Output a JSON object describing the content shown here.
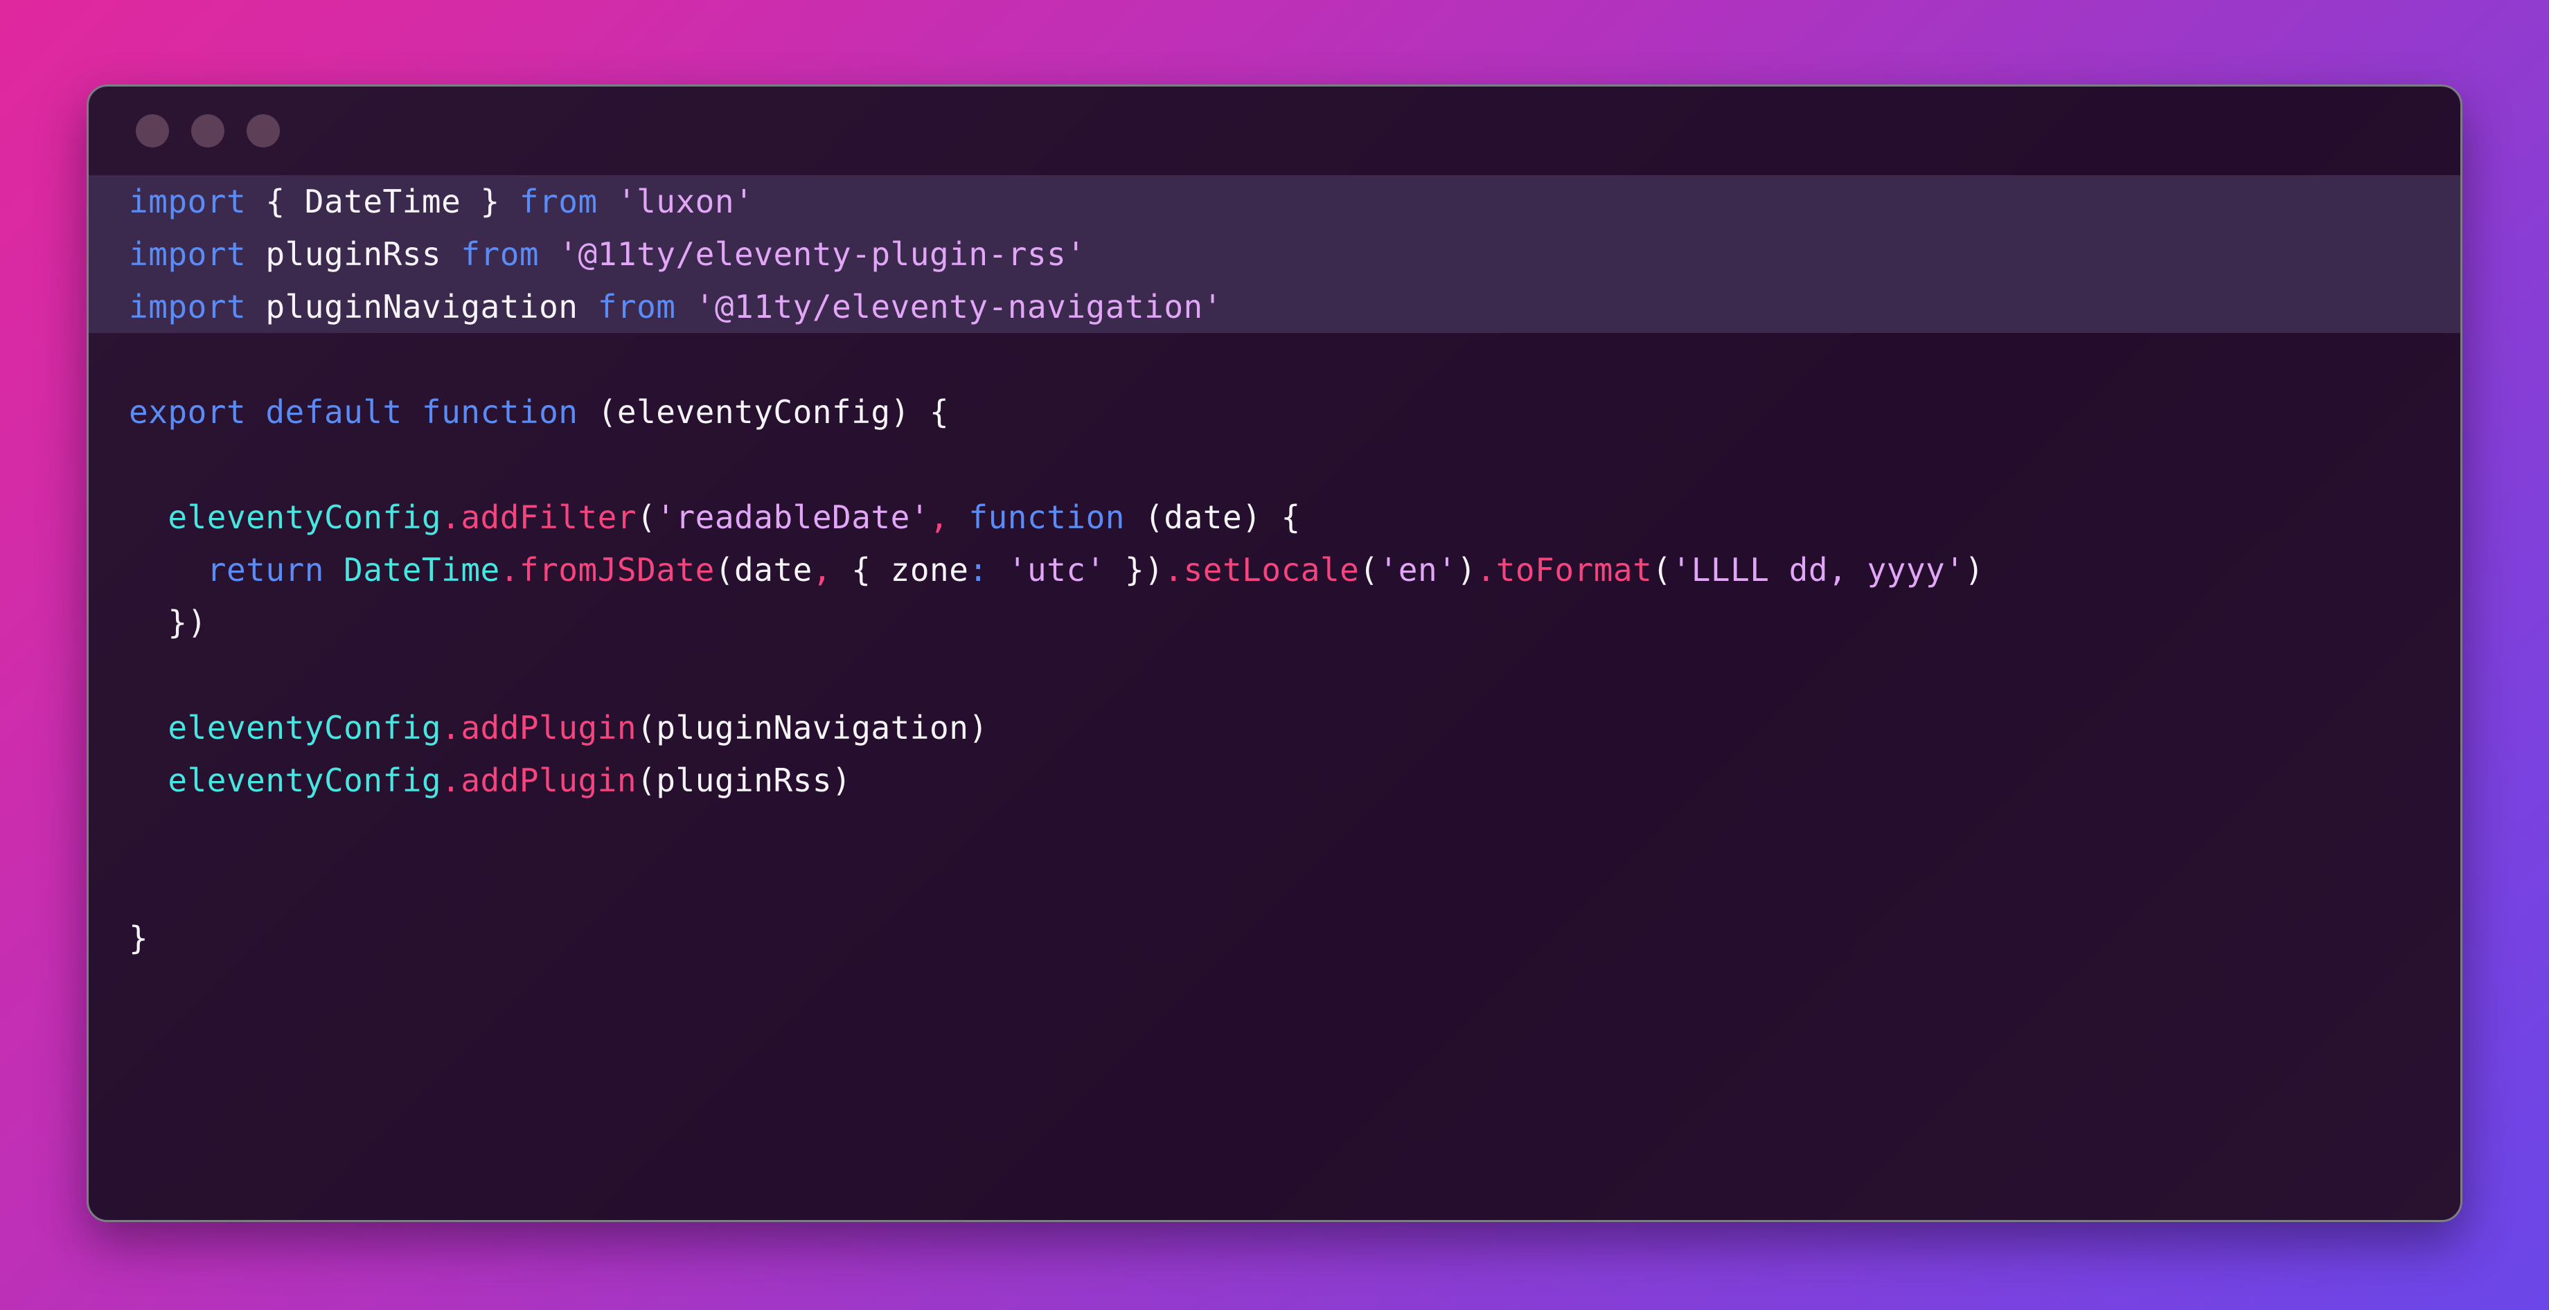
{
  "window": {
    "titlebar": {
      "dots": [
        {
          "name": "close-dot",
          "color": "#5d3f58"
        },
        {
          "name": "minimize-dot",
          "color": "#5d3f58"
        },
        {
          "name": "maximize-dot",
          "color": "#5d3f58"
        }
      ]
    },
    "background_gradient": {
      "from": "#e0289e",
      "to": "#6b46e8",
      "angle_deg": 135
    },
    "surface_color": "#240d2c",
    "highlight_color": "#3b2a4e",
    "border_color": "#7d7d85"
  },
  "theme": {
    "keyword": "#5b8cf5",
    "plain": "#f7f5fa",
    "string": "#e2a6f7",
    "object": "#47e6e0",
    "function": "#f5457f",
    "punctuation": "#f5457f",
    "colon": "#5b8cf5"
  },
  "code": {
    "language": "javascript",
    "filename_hint": "eleventy.config.js",
    "lines": [
      {
        "index": 1,
        "highlighted": true,
        "text": "import { DateTime } from 'luxon'",
        "tokens": [
          {
            "t": "import",
            "c": "kw"
          },
          {
            "t": " ",
            "c": "plain"
          },
          {
            "t": "{ DateTime }",
            "c": "plain"
          },
          {
            "t": " ",
            "c": "plain"
          },
          {
            "t": "from",
            "c": "kw"
          },
          {
            "t": " ",
            "c": "plain"
          },
          {
            "t": "'luxon'",
            "c": "str"
          }
        ]
      },
      {
        "index": 2,
        "highlighted": true,
        "text": "import pluginRss from '@11ty/eleventy-plugin-rss'",
        "tokens": [
          {
            "t": "import",
            "c": "kw"
          },
          {
            "t": " ",
            "c": "plain"
          },
          {
            "t": "pluginRss",
            "c": "plain"
          },
          {
            "t": " ",
            "c": "plain"
          },
          {
            "t": "from",
            "c": "kw"
          },
          {
            "t": " ",
            "c": "plain"
          },
          {
            "t": "'@11ty/eleventy-plugin-rss'",
            "c": "str"
          }
        ]
      },
      {
        "index": 3,
        "highlighted": true,
        "text": "import pluginNavigation from '@11ty/eleventy-navigation'",
        "tokens": [
          {
            "t": "import",
            "c": "kw"
          },
          {
            "t": " ",
            "c": "plain"
          },
          {
            "t": "pluginNavigation",
            "c": "plain"
          },
          {
            "t": " ",
            "c": "plain"
          },
          {
            "t": "from",
            "c": "kw"
          },
          {
            "t": " ",
            "c": "plain"
          },
          {
            "t": "'@11ty/eleventy-navigation'",
            "c": "str"
          }
        ]
      },
      {
        "index": 4,
        "highlighted": false,
        "text": "",
        "tokens": []
      },
      {
        "index": 5,
        "highlighted": false,
        "text": "export default function (eleventyConfig) {",
        "tokens": [
          {
            "t": "export default function",
            "c": "kw"
          },
          {
            "t": " (eleventyConfig) {",
            "c": "plain"
          }
        ]
      },
      {
        "index": 6,
        "highlighted": false,
        "text": "",
        "tokens": []
      },
      {
        "index": 7,
        "highlighted": false,
        "text": "  eleventyConfig.addFilter('readableDate', function (date) {",
        "tokens": [
          {
            "t": "  ",
            "c": "plain"
          },
          {
            "t": "eleventyConfig",
            "c": "obj"
          },
          {
            "t": ".addFilter",
            "c": "fn"
          },
          {
            "t": "(",
            "c": "plain"
          },
          {
            "t": "'readableDate'",
            "c": "str"
          },
          {
            "t": ",",
            "c": "punct"
          },
          {
            "t": " ",
            "c": "plain"
          },
          {
            "t": "function",
            "c": "kw"
          },
          {
            "t": " (date) {",
            "c": "plain"
          }
        ]
      },
      {
        "index": 8,
        "highlighted": false,
        "text": "    return DateTime.fromJSDate(date, { zone: 'utc' }).setLocale('en').toFormat('LLLL dd, yyyy')",
        "wrapped": true,
        "tokens": [
          {
            "t": "    ",
            "c": "plain"
          },
          {
            "t": "return",
            "c": "kw"
          },
          {
            "t": " ",
            "c": "plain"
          },
          {
            "t": "DateTime",
            "c": "obj"
          },
          {
            "t": ".fromJSDate",
            "c": "fn"
          },
          {
            "t": "(date",
            "c": "plain"
          },
          {
            "t": ",",
            "c": "punct"
          },
          {
            "t": " { zone",
            "c": "plain"
          },
          {
            "t": ":",
            "c": "colon"
          },
          {
            "t": " ",
            "c": "plain"
          },
          {
            "t": "'utc'",
            "c": "str"
          },
          {
            "t": " })",
            "c": "plain"
          },
          {
            "t": ".setLocale",
            "c": "fn"
          },
          {
            "t": "(",
            "c": "plain"
          },
          {
            "t": "'en'",
            "c": "str"
          },
          {
            "t": ")",
            "c": "plain"
          },
          {
            "t": ".toFormat",
            "c": "fn"
          },
          {
            "t": "(",
            "c": "plain"
          },
          {
            "t": "'LLLL dd, yyyy'",
            "c": "str"
          },
          {
            "t": ")",
            "c": "plain"
          }
        ]
      },
      {
        "index": 9,
        "highlighted": false,
        "text": "  })",
        "tokens": [
          {
            "t": "  })",
            "c": "plain"
          }
        ]
      },
      {
        "index": 10,
        "highlighted": false,
        "text": "",
        "tokens": []
      },
      {
        "index": 11,
        "highlighted": false,
        "text": "  eleventyConfig.addPlugin(pluginNavigation)",
        "tokens": [
          {
            "t": "  ",
            "c": "plain"
          },
          {
            "t": "eleventyConfig",
            "c": "obj"
          },
          {
            "t": ".addPlugin",
            "c": "fn"
          },
          {
            "t": "(pluginNavigation)",
            "c": "plain"
          }
        ]
      },
      {
        "index": 12,
        "highlighted": false,
        "text": "  eleventyConfig.addPlugin(pluginRss)",
        "tokens": [
          {
            "t": "  ",
            "c": "plain"
          },
          {
            "t": "eleventyConfig",
            "c": "obj"
          },
          {
            "t": ".addPlugin",
            "c": "fn"
          },
          {
            "t": "(pluginRss)",
            "c": "plain"
          }
        ]
      },
      {
        "index": 13,
        "highlighted": false,
        "text": "",
        "tokens": []
      },
      {
        "index": 14,
        "highlighted": false,
        "text": "",
        "tokens": []
      },
      {
        "index": 15,
        "highlighted": false,
        "text": "}",
        "tokens": [
          {
            "t": "}",
            "c": "plain"
          }
        ]
      }
    ]
  }
}
